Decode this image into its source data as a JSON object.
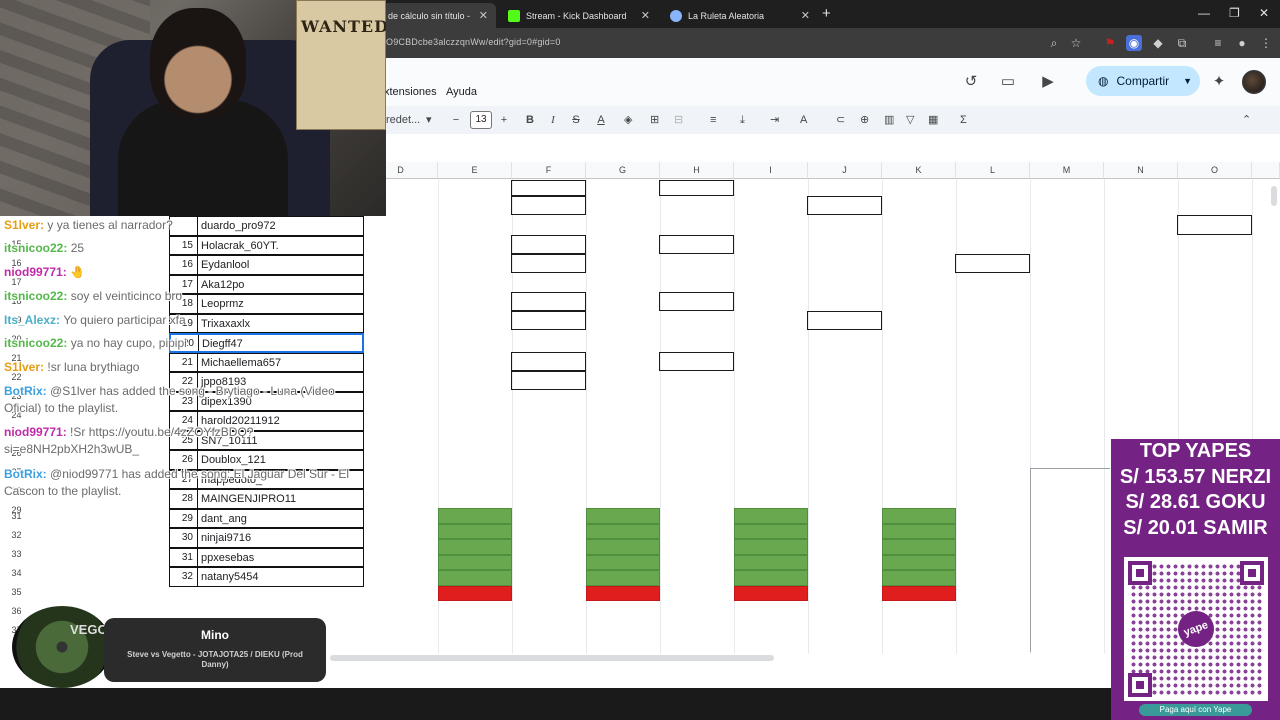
{
  "browser": {
    "tabs": [
      {
        "label": "de cálculo sin título - Hoja",
        "favicon_color": "#ffffff",
        "active": true
      },
      {
        "label": "Stream - Kick Dashboard",
        "favicon_color": "#53fc18",
        "active": false
      },
      {
        "label": "La Ruleta Aleatoria",
        "favicon_color": "#8ab4f8",
        "active": false
      }
    ],
    "close_glyph": "✕",
    "new_tab_glyph": "+",
    "url": "O9CBDcbe3alczzqnWw/edit?gid=0#gid=0",
    "window_controls": [
      "—",
      "❐",
      "✕"
    ]
  },
  "sheets": {
    "menu": [
      "xtensiones",
      "Ayuda"
    ],
    "share_label": "Compartir",
    "toolbar": {
      "font_name": "redet...",
      "font_size": "13",
      "minus": "−",
      "plus": "+",
      "bold": "B",
      "italic": "I",
      "strike": "S",
      "underline_color": "A",
      "functions": "Σ"
    },
    "columns": [
      "D",
      "E",
      "F",
      "G",
      "H",
      "I",
      "J",
      "K",
      "L",
      "M",
      "N",
      "O"
    ],
    "rows": [
      "15",
      "16",
      "17",
      "18",
      "19",
      "20",
      "21",
      "22",
      "23",
      "24",
      "25",
      "26",
      "27",
      "28",
      "29",
      "30",
      "31",
      "32",
      "33",
      "34",
      "35",
      "36",
      "37"
    ],
    "players": [
      {
        "num": "",
        "name": "duardo_pro972"
      },
      {
        "num": "15",
        "name": "Holacrak_60YT."
      },
      {
        "num": "16",
        "name": "Eydanlool"
      },
      {
        "num": "17",
        "name": "Aka12po"
      },
      {
        "num": "18",
        "name": "Leoprmz"
      },
      {
        "num": "19",
        "name": "Trixaxaxlx"
      },
      {
        "num": "20",
        "name": "Diegff47"
      },
      {
        "num": "21",
        "name": "Michaellema657"
      },
      {
        "num": "22",
        "name": "jppo8193"
      },
      {
        "num": "23",
        "name": "dipex1390"
      },
      {
        "num": "24",
        "name": "harold20211912"
      },
      {
        "num": "25",
        "name": "SN7_10111"
      },
      {
        "num": "26",
        "name": "Doublox_121"
      },
      {
        "num": "27",
        "name": "mappedoto_"
      },
      {
        "num": "28",
        "name": "MAINGENJIPRO11"
      },
      {
        "num": "29",
        "name": "dant_ang"
      },
      {
        "num": "30",
        "name": "ninjai9716"
      },
      {
        "num": "31",
        "name": "ppxesebas"
      },
      {
        "num": "32",
        "name": "natany5454"
      }
    ]
  },
  "chat": {
    "messages": [
      {
        "user": "S1lver:",
        "text": "y ya tienes al narrador?",
        "color": "#e69d10"
      },
      {
        "user": "itsnicoo22:",
        "text": "25",
        "color": "#55b84a"
      },
      {
        "user": "niod99771:",
        "text": "🤚",
        "color": "#c02aa9"
      },
      {
        "user": "itsnicoo22:",
        "text": "soy el veinticinco bro",
        "color": "#55b84a"
      },
      {
        "user": "Its_Alexz:",
        "text": "Yo quiero participar xfa",
        "color": "#4ab0c8"
      },
      {
        "user": "itsnicoo22:",
        "text": "ya no hay cupo, pipipi",
        "color": "#55b84a"
      },
      {
        "user": "S1lver:",
        "text": "!sr luna brythiago",
        "color": "#e69d10"
      },
      {
        "user": "BotRix:",
        "text": "@S1lver has added the song - Brytiago - Luna (Video Oficial) to the playlist.",
        "color": "#3aa0e0"
      },
      {
        "user": "niod99771:",
        "text": "!Sr https://youtu.be/4zZOYfzBDQ?si=e8NH2pbXH2h3wUB_",
        "color": "#c02aa9"
      },
      {
        "user": "BotRix:",
        "text": "@niod99771 has added the song: El Jaguar Del Sur - El Cascon to the playlist.",
        "color": "#3aa0e0"
      }
    ]
  },
  "donations": {
    "title": "TOP YAPES",
    "entries": [
      "S/ 153.57 NERZI",
      "S/ 28.61 GOKU",
      "S/ 20.01 SAMIR"
    ],
    "qr_logo": "yape",
    "cta": "Paga aquí con Yape",
    "accent": "#742284"
  },
  "now_playing": {
    "label": "Mino",
    "song": "Steve vs Vegetto - JOTAJOTA25 / DIEKU (Prod Danny)",
    "disc_text": "VEGO"
  },
  "webcam": {
    "poster_text": "WANTED"
  }
}
